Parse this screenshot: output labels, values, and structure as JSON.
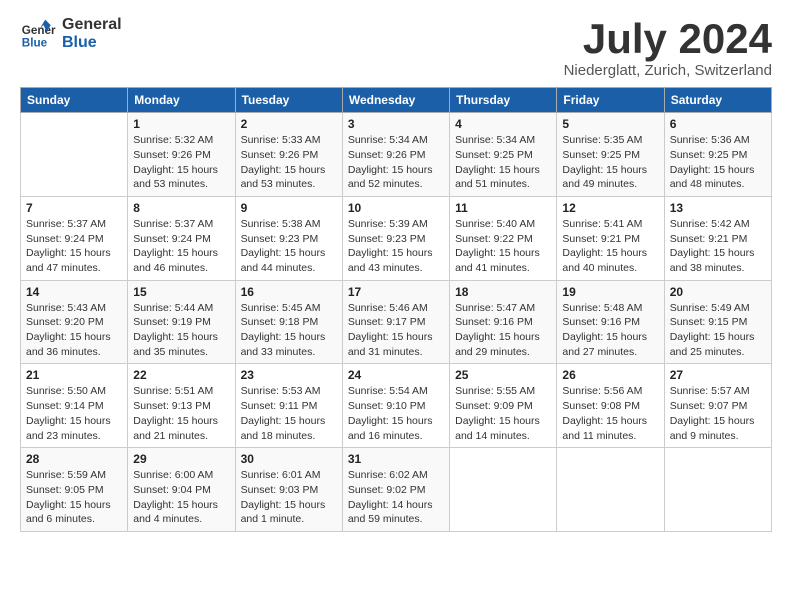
{
  "header": {
    "logo_line1": "General",
    "logo_line2": "Blue",
    "month_title": "July 2024",
    "location": "Niederglatt, Zurich, Switzerland"
  },
  "days_of_week": [
    "Sunday",
    "Monday",
    "Tuesday",
    "Wednesday",
    "Thursday",
    "Friday",
    "Saturday"
  ],
  "weeks": [
    [
      {
        "day": "",
        "detail": ""
      },
      {
        "day": "1",
        "detail": "Sunrise: 5:32 AM\nSunset: 9:26 PM\nDaylight: 15 hours\nand 53 minutes."
      },
      {
        "day": "2",
        "detail": "Sunrise: 5:33 AM\nSunset: 9:26 PM\nDaylight: 15 hours\nand 53 minutes."
      },
      {
        "day": "3",
        "detail": "Sunrise: 5:34 AM\nSunset: 9:26 PM\nDaylight: 15 hours\nand 52 minutes."
      },
      {
        "day": "4",
        "detail": "Sunrise: 5:34 AM\nSunset: 9:25 PM\nDaylight: 15 hours\nand 51 minutes."
      },
      {
        "day": "5",
        "detail": "Sunrise: 5:35 AM\nSunset: 9:25 PM\nDaylight: 15 hours\nand 49 minutes."
      },
      {
        "day": "6",
        "detail": "Sunrise: 5:36 AM\nSunset: 9:25 PM\nDaylight: 15 hours\nand 48 minutes."
      }
    ],
    [
      {
        "day": "7",
        "detail": "Sunrise: 5:37 AM\nSunset: 9:24 PM\nDaylight: 15 hours\nand 47 minutes."
      },
      {
        "day": "8",
        "detail": "Sunrise: 5:37 AM\nSunset: 9:24 PM\nDaylight: 15 hours\nand 46 minutes."
      },
      {
        "day": "9",
        "detail": "Sunrise: 5:38 AM\nSunset: 9:23 PM\nDaylight: 15 hours\nand 44 minutes."
      },
      {
        "day": "10",
        "detail": "Sunrise: 5:39 AM\nSunset: 9:23 PM\nDaylight: 15 hours\nand 43 minutes."
      },
      {
        "day": "11",
        "detail": "Sunrise: 5:40 AM\nSunset: 9:22 PM\nDaylight: 15 hours\nand 41 minutes."
      },
      {
        "day": "12",
        "detail": "Sunrise: 5:41 AM\nSunset: 9:21 PM\nDaylight: 15 hours\nand 40 minutes."
      },
      {
        "day": "13",
        "detail": "Sunrise: 5:42 AM\nSunset: 9:21 PM\nDaylight: 15 hours\nand 38 minutes."
      }
    ],
    [
      {
        "day": "14",
        "detail": "Sunrise: 5:43 AM\nSunset: 9:20 PM\nDaylight: 15 hours\nand 36 minutes."
      },
      {
        "day": "15",
        "detail": "Sunrise: 5:44 AM\nSunset: 9:19 PM\nDaylight: 15 hours\nand 35 minutes."
      },
      {
        "day": "16",
        "detail": "Sunrise: 5:45 AM\nSunset: 9:18 PM\nDaylight: 15 hours\nand 33 minutes."
      },
      {
        "day": "17",
        "detail": "Sunrise: 5:46 AM\nSunset: 9:17 PM\nDaylight: 15 hours\nand 31 minutes."
      },
      {
        "day": "18",
        "detail": "Sunrise: 5:47 AM\nSunset: 9:16 PM\nDaylight: 15 hours\nand 29 minutes."
      },
      {
        "day": "19",
        "detail": "Sunrise: 5:48 AM\nSunset: 9:16 PM\nDaylight: 15 hours\nand 27 minutes."
      },
      {
        "day": "20",
        "detail": "Sunrise: 5:49 AM\nSunset: 9:15 PM\nDaylight: 15 hours\nand 25 minutes."
      }
    ],
    [
      {
        "day": "21",
        "detail": "Sunrise: 5:50 AM\nSunset: 9:14 PM\nDaylight: 15 hours\nand 23 minutes."
      },
      {
        "day": "22",
        "detail": "Sunrise: 5:51 AM\nSunset: 9:13 PM\nDaylight: 15 hours\nand 21 minutes."
      },
      {
        "day": "23",
        "detail": "Sunrise: 5:53 AM\nSunset: 9:11 PM\nDaylight: 15 hours\nand 18 minutes."
      },
      {
        "day": "24",
        "detail": "Sunrise: 5:54 AM\nSunset: 9:10 PM\nDaylight: 15 hours\nand 16 minutes."
      },
      {
        "day": "25",
        "detail": "Sunrise: 5:55 AM\nSunset: 9:09 PM\nDaylight: 15 hours\nand 14 minutes."
      },
      {
        "day": "26",
        "detail": "Sunrise: 5:56 AM\nSunset: 9:08 PM\nDaylight: 15 hours\nand 11 minutes."
      },
      {
        "day": "27",
        "detail": "Sunrise: 5:57 AM\nSunset: 9:07 PM\nDaylight: 15 hours\nand 9 minutes."
      }
    ],
    [
      {
        "day": "28",
        "detail": "Sunrise: 5:59 AM\nSunset: 9:05 PM\nDaylight: 15 hours\nand 6 minutes."
      },
      {
        "day": "29",
        "detail": "Sunrise: 6:00 AM\nSunset: 9:04 PM\nDaylight: 15 hours\nand 4 minutes."
      },
      {
        "day": "30",
        "detail": "Sunrise: 6:01 AM\nSunset: 9:03 PM\nDaylight: 15 hours\nand 1 minute."
      },
      {
        "day": "31",
        "detail": "Sunrise: 6:02 AM\nSunset: 9:02 PM\nDaylight: 14 hours\nand 59 minutes."
      },
      {
        "day": "",
        "detail": ""
      },
      {
        "day": "",
        "detail": ""
      },
      {
        "day": "",
        "detail": ""
      }
    ]
  ]
}
